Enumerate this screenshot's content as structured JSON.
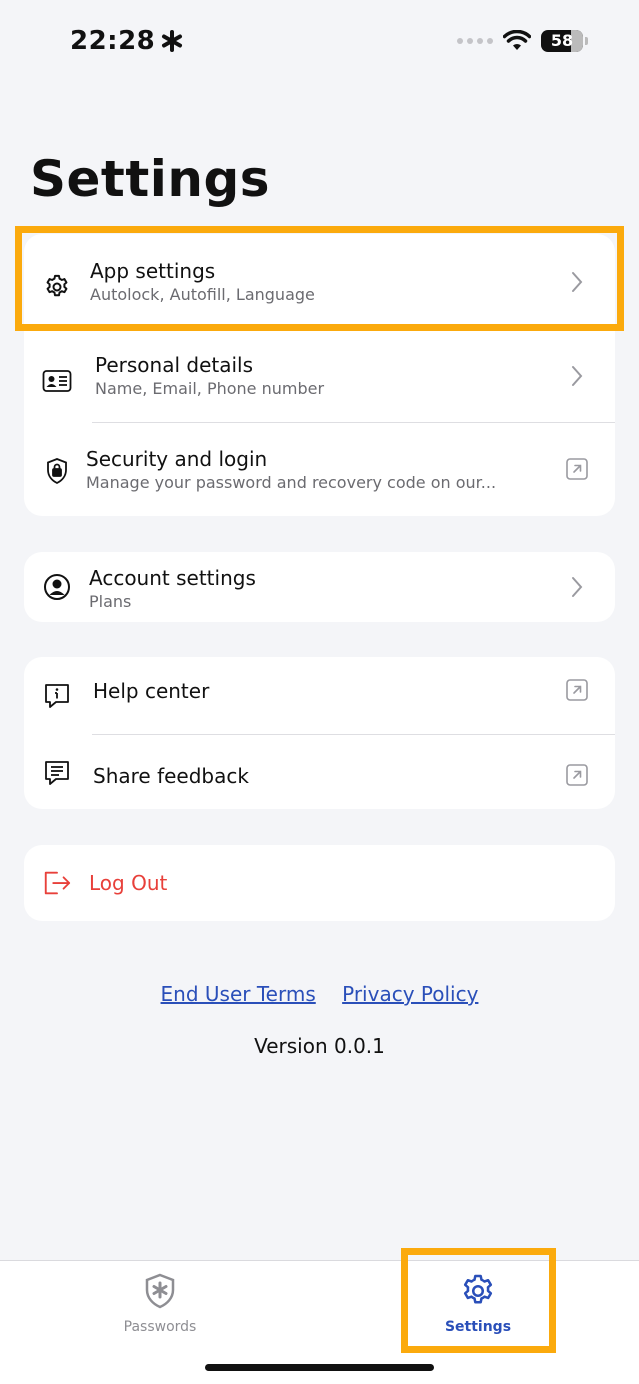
{
  "status": {
    "time": "22:28",
    "battery": "58"
  },
  "header": {
    "title": "Settings"
  },
  "groups": [
    {
      "rows": [
        {
          "title": "App settings",
          "subtitle": "Autolock, Autofill, Language"
        },
        {
          "title": "Personal details",
          "subtitle": "Name, Email, Phone number"
        },
        {
          "title": "Security and login",
          "subtitle": "Manage your password and recovery code on our..."
        }
      ]
    },
    {
      "rows": [
        {
          "title": "Account settings",
          "subtitle": "Plans"
        }
      ]
    },
    {
      "rows": [
        {
          "title": "Help center"
        },
        {
          "title": "Share feedback"
        }
      ]
    }
  ],
  "logout": {
    "label": "Log Out"
  },
  "footer": {
    "terms_label": "End User Terms",
    "privacy_label": "Privacy Policy",
    "version": "Version 0.0.1"
  },
  "tabs": [
    {
      "label": "Passwords",
      "icon": "shield-asterisk-icon"
    },
    {
      "label": "Settings",
      "icon": "gear-icon",
      "active": true
    }
  ],
  "colors": {
    "highlight": "#fbaa0d",
    "link": "#2a4fb9",
    "danger": "#e8403a",
    "tab_active": "#2a4fb9",
    "tab_inactive": "#8e8e93"
  }
}
